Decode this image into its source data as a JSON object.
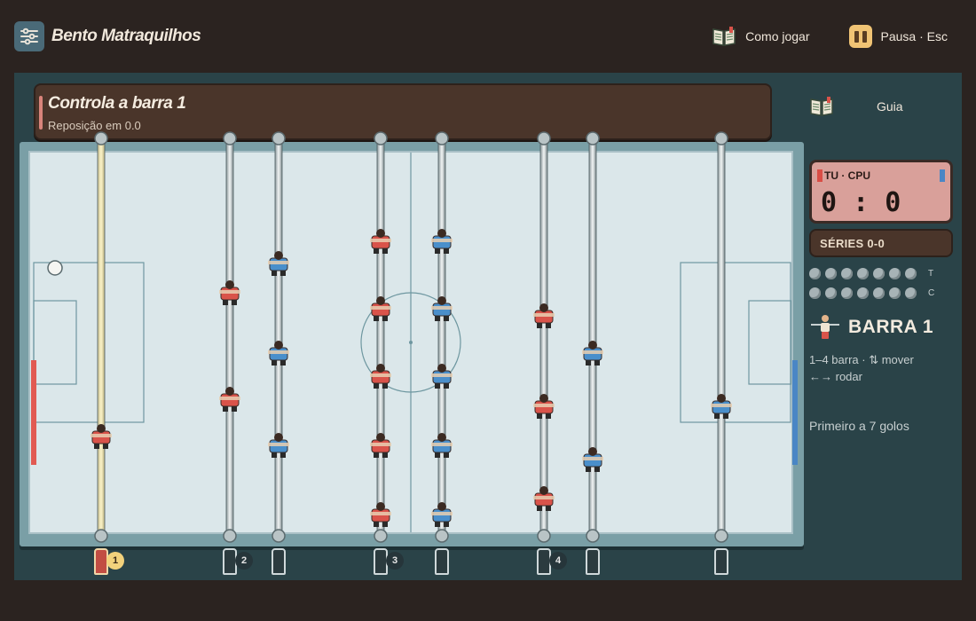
{
  "header": {
    "title": "Bento Matraquilhos",
    "how_to_play": "Como jogar",
    "pause": "Pausa · Esc"
  },
  "banner": {
    "title": "Controla a barra 1",
    "subtitle": "Reposição em 0.0"
  },
  "guide": {
    "label": "Guia"
  },
  "scoreboard": {
    "teams": "TU · CPU",
    "score": "0 : 0",
    "series": "SÉRIES 0-0",
    "row_you_tag": "T",
    "row_cpu_tag": "C",
    "slots_per_row": 7
  },
  "active_rod": {
    "label": "BARRA 1"
  },
  "controls": {
    "line1": "1–4 barra · ⇅ mover",
    "line2": "←→ rodar"
  },
  "target": "Primeiro a 7 golos",
  "colors": {
    "red_team": "#d9534a",
    "blue_team": "#4a8fcb",
    "field": "#dbe7ea",
    "active_rod": "#f2d27c"
  },
  "rod_numbers": [
    "1",
    "2",
    "3",
    "4"
  ]
}
